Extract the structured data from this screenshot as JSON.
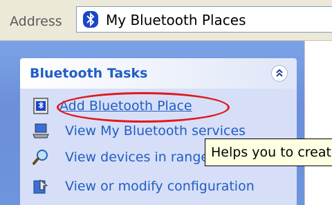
{
  "address_bar": {
    "label": "Address",
    "value": "My Bluetooth Places",
    "icon": "bluetooth-icon"
  },
  "task_pane": {
    "group_title": "Bluetooth Tasks",
    "collapse_icon": "chevron-up-double-icon",
    "tasks": [
      {
        "label": "Add Bluetooth Place",
        "icon": "add-place-icon"
      },
      {
        "label": "View My Bluetooth services",
        "icon": "laptop-icon"
      },
      {
        "label": "View devices in range",
        "icon": "magnifier-icon"
      },
      {
        "label": "View or modify configuration",
        "icon": "config-icon"
      }
    ]
  },
  "tooltip": {
    "text": "Helps you to create"
  },
  "colors": {
    "pane_blue": "#6b8fd8",
    "link_blue": "#215dc6",
    "highlight_red": "#e0191f",
    "tooltip_bg": "#ffffe1"
  }
}
